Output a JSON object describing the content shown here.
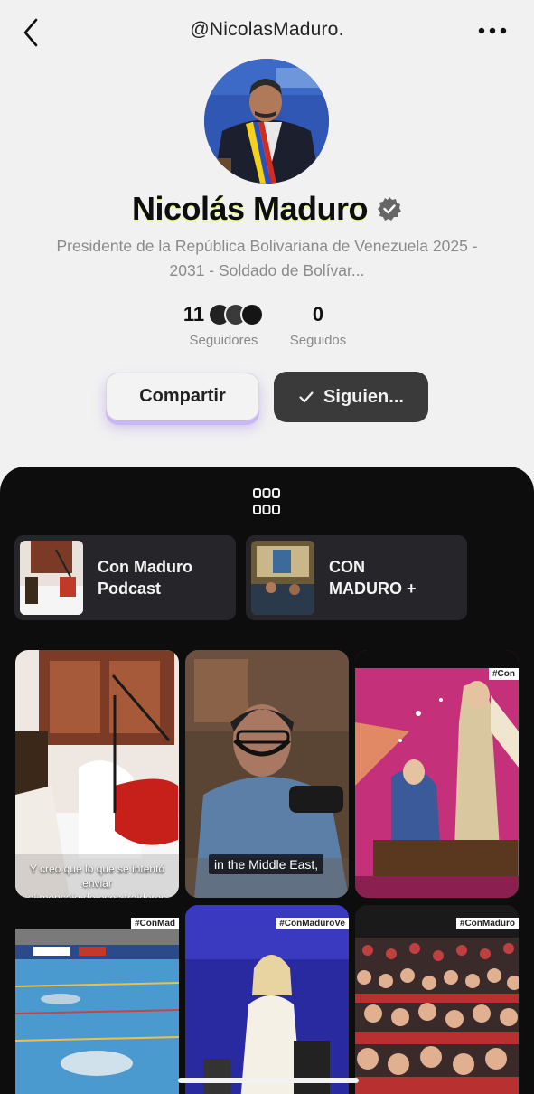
{
  "header": {
    "handle": "@NicolasMaduro.",
    "back_icon": "chevron-left-icon",
    "more_icon": "more-horizontal-icon"
  },
  "profile": {
    "name": "Nicolás Maduro",
    "verified_icon": "verified-badge-icon",
    "bio": "Presidente de la República Bolivariana de Venezuela 2025 - 2031 - Soldado de Bolívar...",
    "followers_count": "11",
    "followers_label": "Seguidores",
    "following_count": "0",
    "following_label": "Seguidos"
  },
  "actions": {
    "share_label": "Compartir",
    "following_label": "Siguien...",
    "following_icon": "check-icon"
  },
  "content": {
    "grid_icon": "grid-icon",
    "collections": [
      {
        "title": "Con Maduro\nPodcast"
      },
      {
        "title": "CON\nMADURO +"
      }
    ],
    "tiles": [
      {
        "caption": "Y creo que lo que se intentó enviar\nel mensaje de esos traidores"
      },
      {
        "caption": "in the Middle East,"
      },
      {
        "tag": "#Con"
      },
      {
        "tag": "#ConMad"
      },
      {
        "tag": "#ConMaduroVe"
      },
      {
        "tag": "#ConMaduro"
      }
    ]
  },
  "colors": {
    "panel_background": "#0d0d0d",
    "following_button": "#3a3a3a",
    "share_glow": "#c9b6f2",
    "name_highlight": "#e9ff8a"
  }
}
